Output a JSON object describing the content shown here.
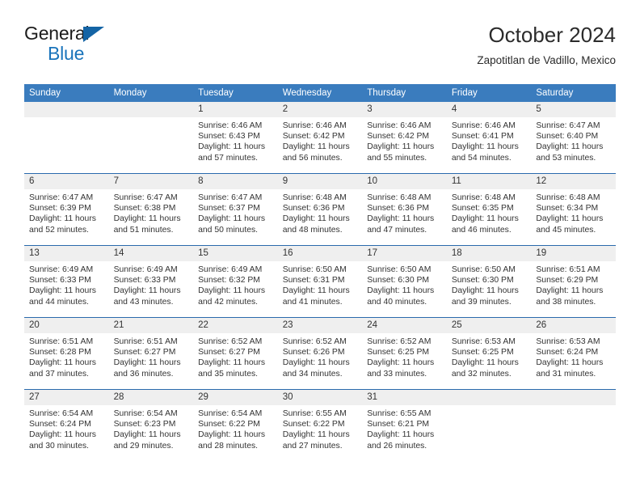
{
  "brand": {
    "name_top": "General",
    "name_bottom": "Blue",
    "flag_color": "#1464a5",
    "blue_text_color": "#1a74bb"
  },
  "header": {
    "title": "October 2024",
    "subtitle": "Zapotitlan de Vadillo, Mexico"
  },
  "theme": {
    "header_bg": "#3a7cbe",
    "daynum_bg": "#efefef",
    "rule_color": "#2a6aad",
    "text_color": "#333333"
  },
  "weekdays": [
    "Sunday",
    "Monday",
    "Tuesday",
    "Wednesday",
    "Thursday",
    "Friday",
    "Saturday"
  ],
  "weeks": [
    [
      {
        "day": "",
        "blank": true
      },
      {
        "day": "",
        "blank": true
      },
      {
        "day": "1",
        "sunrise": "Sunrise: 6:46 AM",
        "sunset": "Sunset: 6:43 PM",
        "daylight1": "Daylight: 11 hours",
        "daylight2": "and 57 minutes."
      },
      {
        "day": "2",
        "sunrise": "Sunrise: 6:46 AM",
        "sunset": "Sunset: 6:42 PM",
        "daylight1": "Daylight: 11 hours",
        "daylight2": "and 56 minutes."
      },
      {
        "day": "3",
        "sunrise": "Sunrise: 6:46 AM",
        "sunset": "Sunset: 6:42 PM",
        "daylight1": "Daylight: 11 hours",
        "daylight2": "and 55 minutes."
      },
      {
        "day": "4",
        "sunrise": "Sunrise: 6:46 AM",
        "sunset": "Sunset: 6:41 PM",
        "daylight1": "Daylight: 11 hours",
        "daylight2": "and 54 minutes."
      },
      {
        "day": "5",
        "sunrise": "Sunrise: 6:47 AM",
        "sunset": "Sunset: 6:40 PM",
        "daylight1": "Daylight: 11 hours",
        "daylight2": "and 53 minutes."
      }
    ],
    [
      {
        "day": "6",
        "sunrise": "Sunrise: 6:47 AM",
        "sunset": "Sunset: 6:39 PM",
        "daylight1": "Daylight: 11 hours",
        "daylight2": "and 52 minutes."
      },
      {
        "day": "7",
        "sunrise": "Sunrise: 6:47 AM",
        "sunset": "Sunset: 6:38 PM",
        "daylight1": "Daylight: 11 hours",
        "daylight2": "and 51 minutes."
      },
      {
        "day": "8",
        "sunrise": "Sunrise: 6:47 AM",
        "sunset": "Sunset: 6:37 PM",
        "daylight1": "Daylight: 11 hours",
        "daylight2": "and 50 minutes."
      },
      {
        "day": "9",
        "sunrise": "Sunrise: 6:48 AM",
        "sunset": "Sunset: 6:36 PM",
        "daylight1": "Daylight: 11 hours",
        "daylight2": "and 48 minutes."
      },
      {
        "day": "10",
        "sunrise": "Sunrise: 6:48 AM",
        "sunset": "Sunset: 6:36 PM",
        "daylight1": "Daylight: 11 hours",
        "daylight2": "and 47 minutes."
      },
      {
        "day": "11",
        "sunrise": "Sunrise: 6:48 AM",
        "sunset": "Sunset: 6:35 PM",
        "daylight1": "Daylight: 11 hours",
        "daylight2": "and 46 minutes."
      },
      {
        "day": "12",
        "sunrise": "Sunrise: 6:48 AM",
        "sunset": "Sunset: 6:34 PM",
        "daylight1": "Daylight: 11 hours",
        "daylight2": "and 45 minutes."
      }
    ],
    [
      {
        "day": "13",
        "sunrise": "Sunrise: 6:49 AM",
        "sunset": "Sunset: 6:33 PM",
        "daylight1": "Daylight: 11 hours",
        "daylight2": "and 44 minutes."
      },
      {
        "day": "14",
        "sunrise": "Sunrise: 6:49 AM",
        "sunset": "Sunset: 6:33 PM",
        "daylight1": "Daylight: 11 hours",
        "daylight2": "and 43 minutes."
      },
      {
        "day": "15",
        "sunrise": "Sunrise: 6:49 AM",
        "sunset": "Sunset: 6:32 PM",
        "daylight1": "Daylight: 11 hours",
        "daylight2": "and 42 minutes."
      },
      {
        "day": "16",
        "sunrise": "Sunrise: 6:50 AM",
        "sunset": "Sunset: 6:31 PM",
        "daylight1": "Daylight: 11 hours",
        "daylight2": "and 41 minutes."
      },
      {
        "day": "17",
        "sunrise": "Sunrise: 6:50 AM",
        "sunset": "Sunset: 6:30 PM",
        "daylight1": "Daylight: 11 hours",
        "daylight2": "and 40 minutes."
      },
      {
        "day": "18",
        "sunrise": "Sunrise: 6:50 AM",
        "sunset": "Sunset: 6:30 PM",
        "daylight1": "Daylight: 11 hours",
        "daylight2": "and 39 minutes."
      },
      {
        "day": "19",
        "sunrise": "Sunrise: 6:51 AM",
        "sunset": "Sunset: 6:29 PM",
        "daylight1": "Daylight: 11 hours",
        "daylight2": "and 38 minutes."
      }
    ],
    [
      {
        "day": "20",
        "sunrise": "Sunrise: 6:51 AM",
        "sunset": "Sunset: 6:28 PM",
        "daylight1": "Daylight: 11 hours",
        "daylight2": "and 37 minutes."
      },
      {
        "day": "21",
        "sunrise": "Sunrise: 6:51 AM",
        "sunset": "Sunset: 6:27 PM",
        "daylight1": "Daylight: 11 hours",
        "daylight2": "and 36 minutes."
      },
      {
        "day": "22",
        "sunrise": "Sunrise: 6:52 AM",
        "sunset": "Sunset: 6:27 PM",
        "daylight1": "Daylight: 11 hours",
        "daylight2": "and 35 minutes."
      },
      {
        "day": "23",
        "sunrise": "Sunrise: 6:52 AM",
        "sunset": "Sunset: 6:26 PM",
        "daylight1": "Daylight: 11 hours",
        "daylight2": "and 34 minutes."
      },
      {
        "day": "24",
        "sunrise": "Sunrise: 6:52 AM",
        "sunset": "Sunset: 6:25 PM",
        "daylight1": "Daylight: 11 hours",
        "daylight2": "and 33 minutes."
      },
      {
        "day": "25",
        "sunrise": "Sunrise: 6:53 AM",
        "sunset": "Sunset: 6:25 PM",
        "daylight1": "Daylight: 11 hours",
        "daylight2": "and 32 minutes."
      },
      {
        "day": "26",
        "sunrise": "Sunrise: 6:53 AM",
        "sunset": "Sunset: 6:24 PM",
        "daylight1": "Daylight: 11 hours",
        "daylight2": "and 31 minutes."
      }
    ],
    [
      {
        "day": "27",
        "sunrise": "Sunrise: 6:54 AM",
        "sunset": "Sunset: 6:24 PM",
        "daylight1": "Daylight: 11 hours",
        "daylight2": "and 30 minutes."
      },
      {
        "day": "28",
        "sunrise": "Sunrise: 6:54 AM",
        "sunset": "Sunset: 6:23 PM",
        "daylight1": "Daylight: 11 hours",
        "daylight2": "and 29 minutes."
      },
      {
        "day": "29",
        "sunrise": "Sunrise: 6:54 AM",
        "sunset": "Sunset: 6:22 PM",
        "daylight1": "Daylight: 11 hours",
        "daylight2": "and 28 minutes."
      },
      {
        "day": "30",
        "sunrise": "Sunrise: 6:55 AM",
        "sunset": "Sunset: 6:22 PM",
        "daylight1": "Daylight: 11 hours",
        "daylight2": "and 27 minutes."
      },
      {
        "day": "31",
        "sunrise": "Sunrise: 6:55 AM",
        "sunset": "Sunset: 6:21 PM",
        "daylight1": "Daylight: 11 hours",
        "daylight2": "and 26 minutes."
      },
      {
        "day": "",
        "blank": true
      },
      {
        "day": "",
        "blank": true
      }
    ]
  ]
}
